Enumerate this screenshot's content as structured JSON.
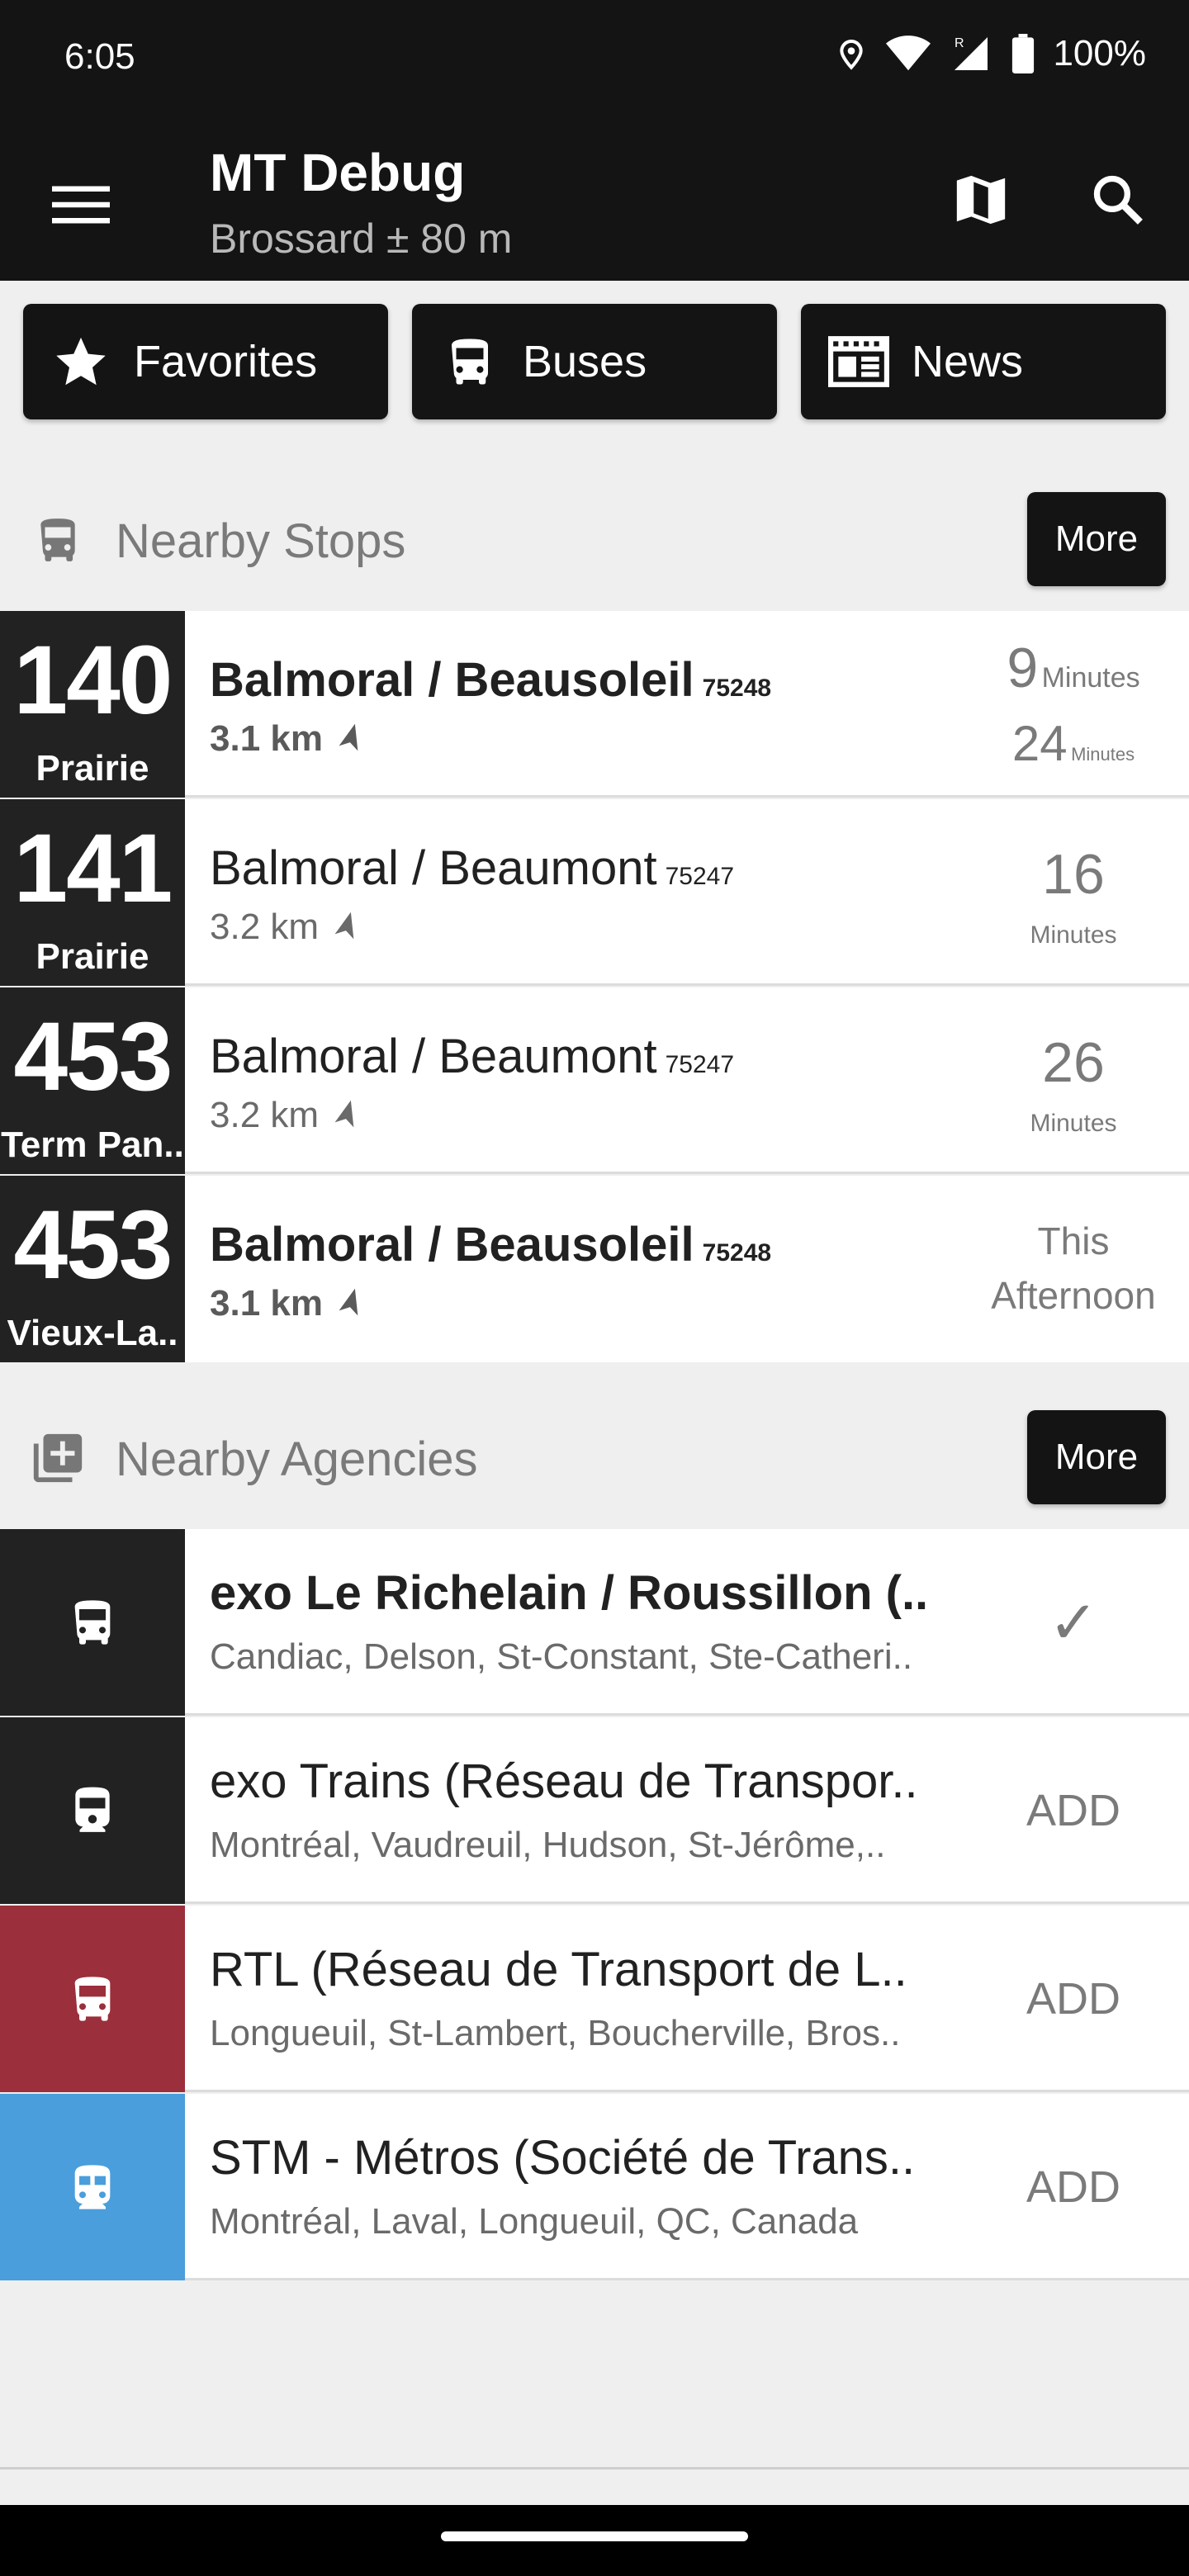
{
  "status_bar": {
    "time": "6:05",
    "battery": "100%",
    "icons": [
      "location-icon",
      "wifi-icon",
      "signal-icon",
      "battery-icon"
    ]
  },
  "toolbar": {
    "title": "MT Debug",
    "subtitle": "Brossard ± 80 m",
    "icons": [
      "menu-icon",
      "map-icon",
      "search-icon"
    ]
  },
  "shortcuts": [
    {
      "label": "Favorites",
      "icon": "star-icon"
    },
    {
      "label": "Buses",
      "icon": "bus-icon"
    },
    {
      "label": "News",
      "icon": "news-icon"
    }
  ],
  "nearby_stops": {
    "title": "Nearby Stops",
    "more_label": "More",
    "rows": [
      {
        "route": "140",
        "dest": "Prairie",
        "stop": "Balmoral / Beausoleil",
        "code": "75248",
        "dist": "3.1 km",
        "bold": true,
        "times": [
          {
            "value": "9",
            "unit": "Minutes"
          },
          {
            "value": "24",
            "unit": "Minutes"
          }
        ]
      },
      {
        "route": "141",
        "dest": "Prairie",
        "stop": "Balmoral / Beaumont",
        "code": "75247",
        "dist": "3.2 km",
        "bold": false,
        "times": [
          {
            "value": "16",
            "unit": "Minutes"
          }
        ]
      },
      {
        "route": "453",
        "dest": "Term Pan..",
        "stop": "Balmoral / Beaumont",
        "code": "75247",
        "dist": "3.2 km",
        "bold": false,
        "times": [
          {
            "value": "26",
            "unit": "Minutes"
          }
        ]
      },
      {
        "route": "453",
        "dest": "Vieux-La..",
        "stop": "Balmoral / Beausoleil",
        "code": "75248",
        "dist": "3.1 km",
        "bold": true,
        "times_text": [
          "This",
          "Afternoon"
        ]
      }
    ]
  },
  "nearby_agencies": {
    "title": "Nearby Agencies",
    "more_label": "More",
    "rows": [
      {
        "name": "exo Le Richelain / Roussillon (..",
        "areas": "Candiac, Delson, St-Constant, Ste-Catheri..",
        "action": "✓",
        "color": "#222222",
        "bold": true,
        "icon": "bus-icon"
      },
      {
        "name": "exo Trains (Réseau de Transpor..",
        "areas": "Montréal, Vaudreuil, Hudson, St-Jérôme,..",
        "action": "ADD",
        "color": "#222222",
        "bold": false,
        "icon": "train-icon"
      },
      {
        "name": "RTL (Réseau de Transport de L..",
        "areas": "Longueuil, St-Lambert, Boucherville, Bros..",
        "action": "ADD",
        "color": "#9b2f3b",
        "bold": false,
        "icon": "bus-icon"
      },
      {
        "name": "STM - Métros (Société de Trans..",
        "areas": "Montréal, Laval, Longueuil, QC, Canada",
        "action": "ADD",
        "color": "#4a9edb",
        "bold": false,
        "icon": "subway-icon"
      }
    ]
  }
}
